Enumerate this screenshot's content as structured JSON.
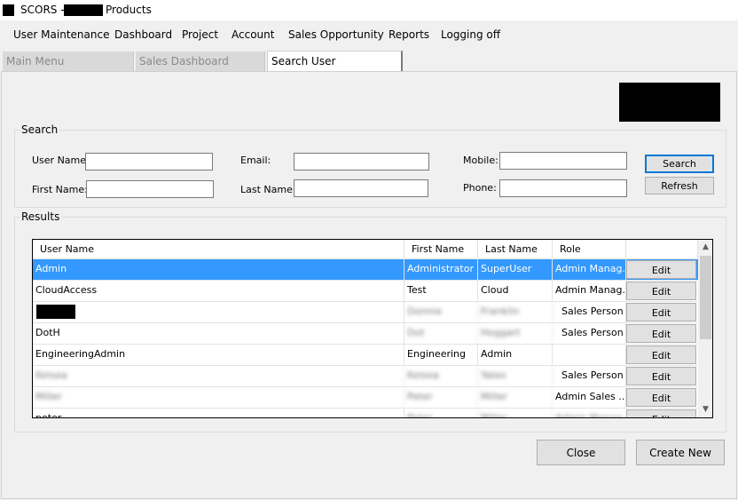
{
  "window": {
    "title_prefix": "SCORS - ",
    "title_suffix": "Products"
  },
  "menu": [
    "User Maintenance",
    "Dashboard",
    "Project",
    "Account",
    "Sales Opportunity",
    "Reports",
    "Logging off"
  ],
  "tabs": [
    {
      "label": "Main Menu",
      "active": false
    },
    {
      "label": "Sales Dashboard",
      "active": false
    },
    {
      "label": "Search User",
      "active": true
    }
  ],
  "search": {
    "title": "Search",
    "user_name_label": "User Name:",
    "first_name_label": "First Name:",
    "email_label": "Email:",
    "last_name_label": "Last Name:",
    "mobile_label": "Mobile:",
    "phone_label": "Phone:",
    "user_name_value": "",
    "first_name_value": "",
    "email_value": "",
    "last_name_value": "",
    "mobile_value": "",
    "phone_value": "",
    "search_button": "Search",
    "refresh_button": "Refresh"
  },
  "results": {
    "title": "Results",
    "columns": [
      "User Name",
      "First Name",
      "Last Name",
      "Role",
      ""
    ],
    "rows": [
      {
        "user": "Admin",
        "first": "Administrator",
        "last": "SuperUser",
        "role": "Admin Manag...",
        "edit": "Edit",
        "selected": true
      },
      {
        "user": "CloudAccess",
        "first": "Test",
        "last": "Cloud",
        "role": "Admin Manag...",
        "edit": "Edit",
        "selected": false
      },
      {
        "user": "",
        "first": "Donnie",
        "last": "Franklin",
        "role": "Sales Person",
        "edit": "Edit",
        "selected": false
      },
      {
        "user": "DotH",
        "first": "Dot",
        "last": "Hoggart",
        "role": "Sales Person",
        "edit": "Edit",
        "selected": false
      },
      {
        "user": "EngineeringAdmin",
        "first": "Engineering",
        "last": "Admin",
        "role": "",
        "edit": "Edit",
        "selected": false
      },
      {
        "user": "Kelsea",
        "first": "Kelsea",
        "last": "Yates",
        "role": "Sales Person",
        "edit": "Edit",
        "selected": false
      },
      {
        "user": "Miller",
        "first": "Peter",
        "last": "Miller",
        "role": "Admin  Sales ...",
        "edit": "Edit",
        "selected": false
      },
      {
        "user": "peter",
        "first": "Peter",
        "last": "Miller",
        "role": "Admin Manag...",
        "edit": "Edit",
        "selected": false
      }
    ]
  },
  "footer": {
    "close_button": "Close",
    "create_button": "Create New"
  },
  "colors": {
    "selection": "#3399ff",
    "focus_border": "#0078d7"
  }
}
